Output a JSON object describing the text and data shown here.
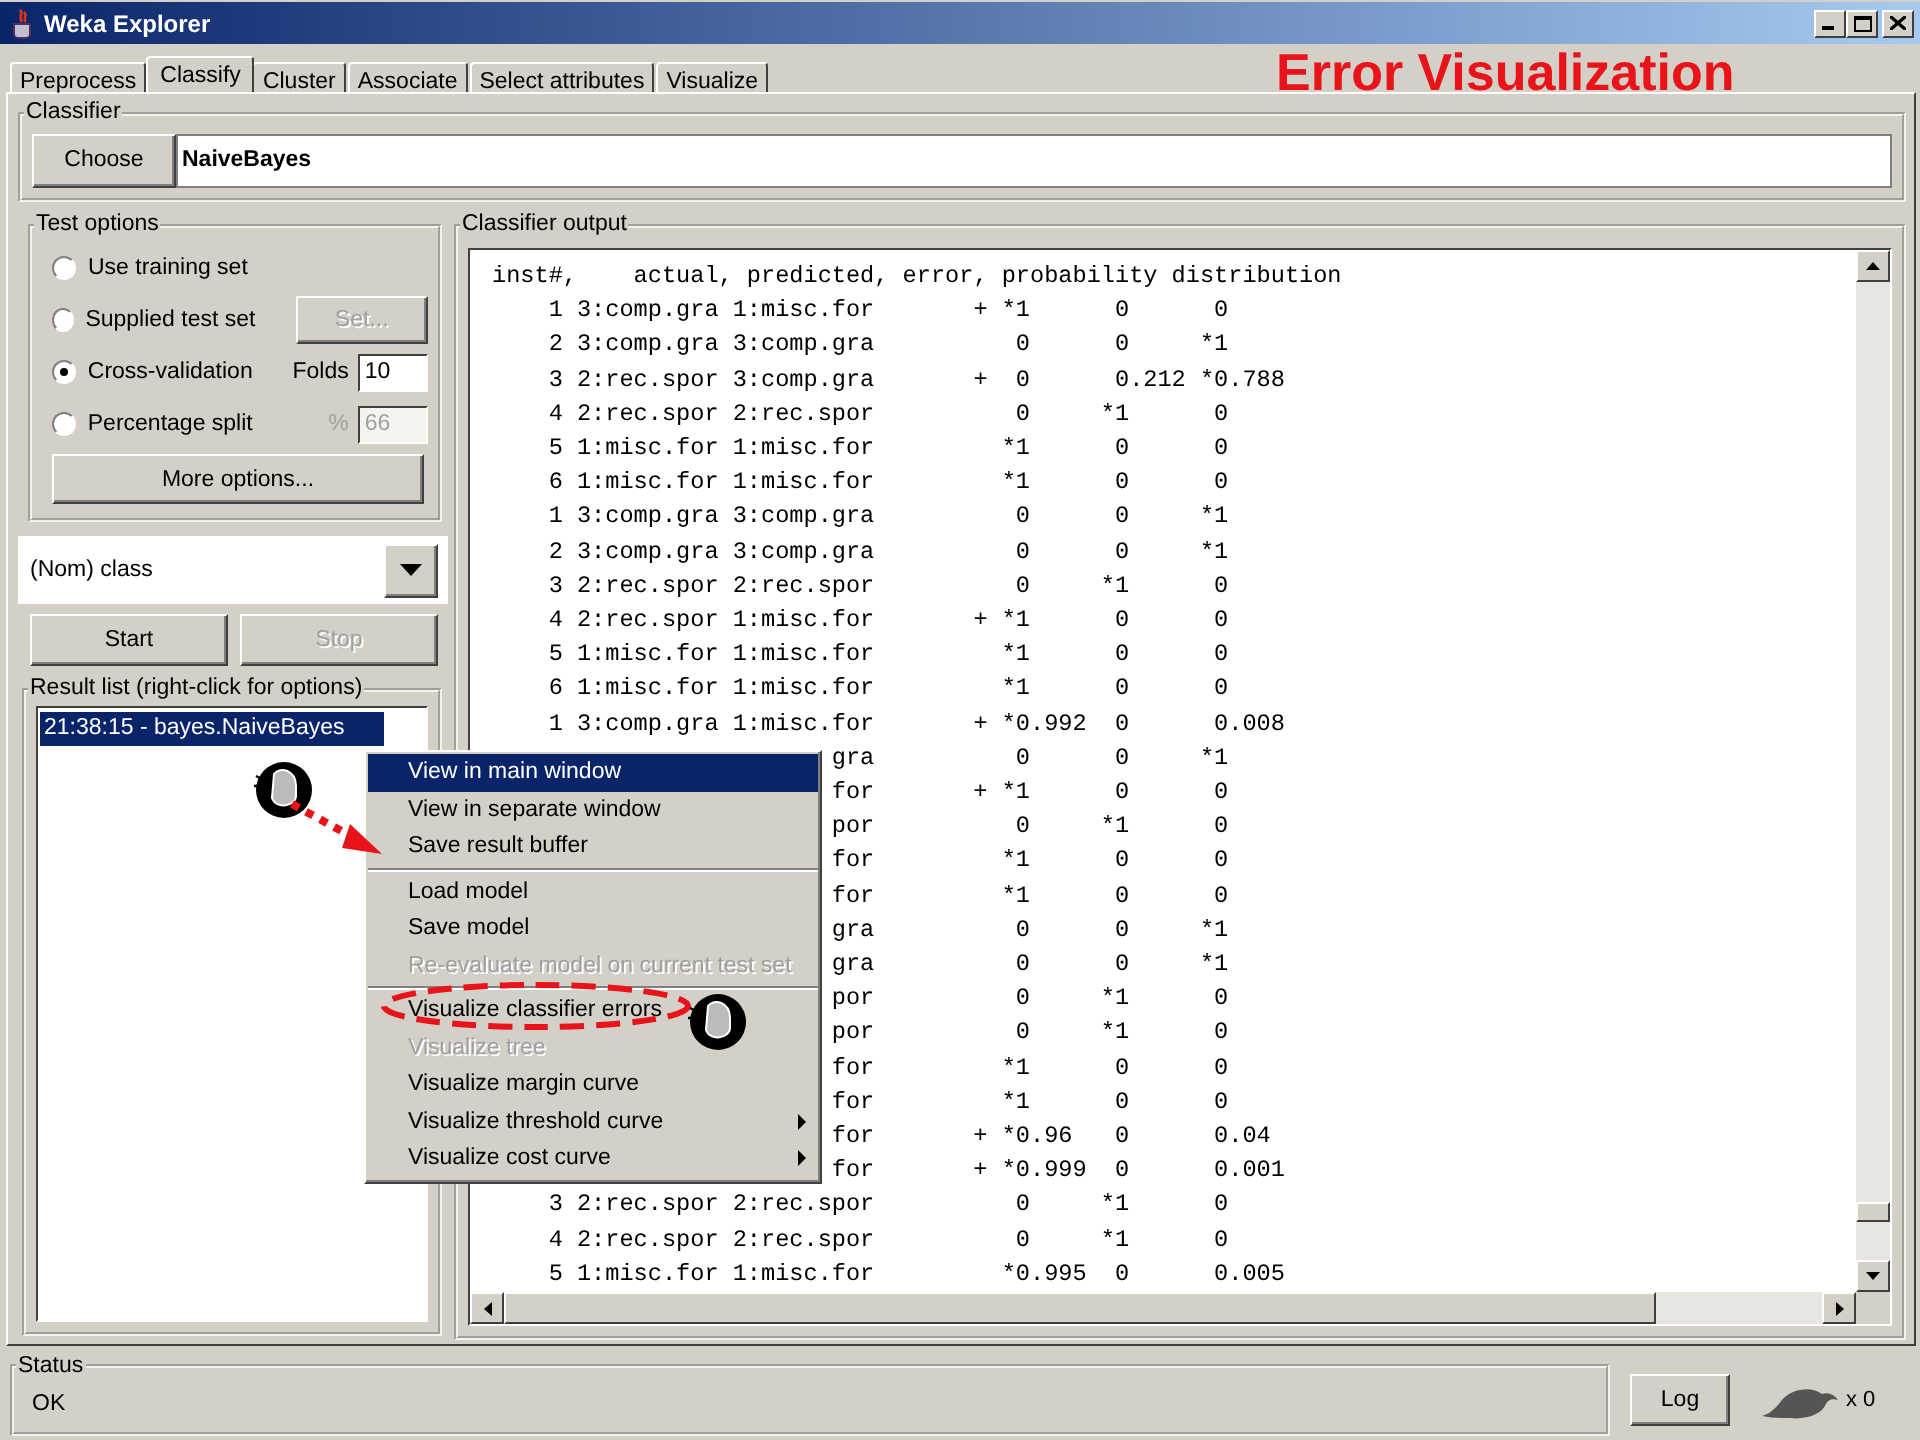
{
  "window": {
    "title": "Weka Explorer"
  },
  "annotation_title": "Error Visualization",
  "tabs": [
    {
      "label": "Preprocess",
      "selected": false
    },
    {
      "label": "Classify",
      "selected": true
    },
    {
      "label": "Cluster",
      "selected": false
    },
    {
      "label": "Associate",
      "selected": false
    },
    {
      "label": "Select attributes",
      "selected": false
    },
    {
      "label": "Visualize",
      "selected": false
    }
  ],
  "classifier": {
    "group_label": "Classifier",
    "button": "Choose",
    "value": "NaiveBayes"
  },
  "test_options": {
    "group_label": "Test options",
    "options": [
      {
        "kind": "plain",
        "label": "Use training set",
        "selected": false
      },
      {
        "kind": "button",
        "label": "Supplied test set",
        "selected": false,
        "button": "Set...",
        "disabled": true
      },
      {
        "kind": "field",
        "label": "Cross-validation",
        "selected": true,
        "field_label": "Folds",
        "value": "10",
        "disabled": false
      },
      {
        "kind": "field",
        "label": "Percentage split",
        "selected": false,
        "field_label": "%",
        "value": "66",
        "disabled": true
      }
    ],
    "more_button": "More options..."
  },
  "class_select": {
    "value": "(Nom) class"
  },
  "start_button": {
    "label": "Start",
    "disabled": false
  },
  "stop_button": {
    "label": "Stop",
    "disabled": true
  },
  "result_list": {
    "group_label": "Result list (right-click for options)",
    "items": [
      {
        "label": "21:38:15 - bayes.NaiveBayes",
        "selected": true
      }
    ]
  },
  "output": {
    "group_label": "Classifier output",
    "lines": [
      {
        "kind": "full",
        "text": "inst#,    actual, predicted, error, probability distribution"
      },
      {
        "kind": "full",
        "text": "    1 3:comp.gra 1:misc.for       + *1      0      0"
      },
      {
        "kind": "full",
        "text": "    2 3:comp.gra 3:comp.gra          0      0     *1"
      },
      {
        "kind": "full",
        "text": "    3 2:rec.spor 3:comp.gra       +  0      0.212 *0.788"
      },
      {
        "kind": "full",
        "text": "    4 2:rec.spor 2:rec.spor          0     *1      0"
      },
      {
        "kind": "full",
        "text": "    5 1:misc.for 1:misc.for         *1      0      0"
      },
      {
        "kind": "full",
        "text": "    6 1:misc.for 1:misc.for         *1      0      0"
      },
      {
        "kind": "full",
        "text": "    1 3:comp.gra 3:comp.gra          0      0     *1"
      },
      {
        "kind": "full",
        "text": "    2 3:comp.gra 3:comp.gra          0      0     *1"
      },
      {
        "kind": "full",
        "text": "    3 2:rec.spor 2:rec.spor          0     *1      0"
      },
      {
        "kind": "full",
        "text": "    4 2:rec.spor 1:misc.for       + *1      0      0"
      },
      {
        "kind": "full",
        "text": "    5 1:misc.for 1:misc.for         *1      0      0"
      },
      {
        "kind": "full",
        "text": "    6 1:misc.for 1:misc.for         *1      0      0"
      },
      {
        "kind": "full",
        "text": "    1 3:comp.gra 1:misc.for       + *0.992  0      0.008"
      },
      {
        "kind": "tail",
        "text": "gra          0      0     *1"
      },
      {
        "kind": "tail",
        "text": "for       + *1      0      0"
      },
      {
        "kind": "tail",
        "text": "por          0     *1      0"
      },
      {
        "kind": "tail",
        "text": "for         *1      0      0"
      },
      {
        "kind": "tail",
        "text": "for         *1      0      0"
      },
      {
        "kind": "tail",
        "text": "gra          0      0     *1"
      },
      {
        "kind": "tail",
        "text": "gra          0      0     *1"
      },
      {
        "kind": "tail",
        "text": "por          0     *1      0"
      },
      {
        "kind": "tail",
        "text": "por          0     *1      0"
      },
      {
        "kind": "tail",
        "text": "for         *1      0      0"
      },
      {
        "kind": "tail",
        "text": "for         *1      0      0"
      },
      {
        "kind": "tail",
        "text": "for       + *0.96   0      0.04"
      },
      {
        "kind": "tail",
        "text": "for       + *0.999  0      0.001"
      },
      {
        "kind": "full",
        "text": "    3 2:rec.spor 2:rec.spor          0     *1      0"
      },
      {
        "kind": "full",
        "text": "    4 2:rec.spor 2:rec.spor          0     *1      0"
      },
      {
        "kind": "full",
        "text": "    5 1:misc.for 1:misc.for         *0.995  0      0.005"
      }
    ]
  },
  "context_menu": {
    "sections": [
      [
        {
          "label": "View in main window",
          "selected": true,
          "disabled": false,
          "submenu": false
        },
        {
          "label": "View in separate window",
          "selected": false,
          "disabled": false,
          "submenu": false
        },
        {
          "label": "Save result buffer",
          "selected": false,
          "disabled": false,
          "submenu": false
        }
      ],
      [
        {
          "label": "Load model",
          "selected": false,
          "disabled": false,
          "submenu": false
        },
        {
          "label": "Save model",
          "selected": false,
          "disabled": false,
          "submenu": false
        },
        {
          "label": "Re-evaluate model on current test set",
          "selected": false,
          "disabled": true,
          "submenu": false
        }
      ],
      [
        {
          "label": "Visualize classifier errors",
          "selected": false,
          "disabled": false,
          "submenu": false
        },
        {
          "label": "Visualize tree",
          "selected": false,
          "disabled": true,
          "submenu": false
        },
        {
          "label": "Visualize margin curve",
          "selected": false,
          "disabled": false,
          "submenu": false
        },
        {
          "label": "Visualize threshold curve",
          "selected": false,
          "disabled": false,
          "submenu": true
        },
        {
          "label": "Visualize cost curve",
          "selected": false,
          "disabled": false,
          "submenu": true
        }
      ]
    ]
  },
  "status": {
    "group_label": "Status",
    "text": "OK"
  },
  "log_button": "Log",
  "task_count": "x 0"
}
